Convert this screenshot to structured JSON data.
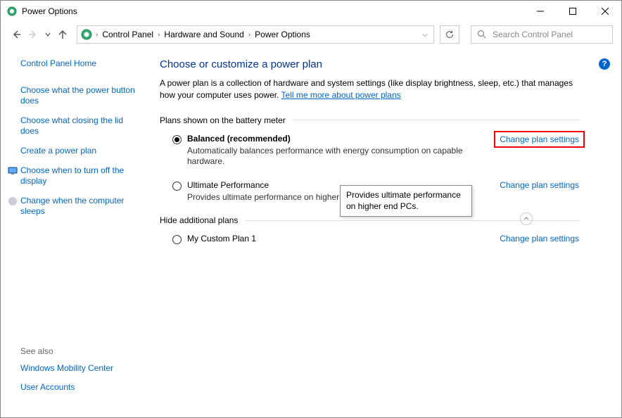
{
  "window": {
    "title": "Power Options"
  },
  "breadcrumb": {
    "items": [
      "Control Panel",
      "Hardware and Sound",
      "Power Options"
    ]
  },
  "search": {
    "placeholder": "Search Control Panel"
  },
  "sidebar": {
    "home": "Control Panel Home",
    "links": [
      "Choose what the power button does",
      "Choose what closing the lid does",
      "Create a power plan",
      "Choose when to turn off the display",
      "Change when the computer sleeps"
    ],
    "see_also_title": "See also",
    "see_also": [
      "Windows Mobility Center",
      "User Accounts"
    ]
  },
  "main": {
    "heading": "Choose or customize a power plan",
    "description": "A power plan is a collection of hardware and system settings (like display brightness, sleep, etc.) that manages how your computer uses power. ",
    "learn_more": "Tell me more about power plans",
    "section1_title": "Plans shown on the battery meter",
    "section2_title": "Hide additional plans",
    "change_link": "Change plan settings",
    "plans": [
      {
        "name": "Balanced (recommended)",
        "desc": "Automatically balances performance with energy consumption on capable hardware.",
        "selected": true
      },
      {
        "name": "Ultimate Performance",
        "desc": "Provides ultimate performance on higher en",
        "selected": false
      }
    ],
    "additional_plans": [
      {
        "name": "My Custom Plan 1",
        "selected": false
      }
    ],
    "tooltip": "Provides ultimate performance on higher end PCs."
  }
}
